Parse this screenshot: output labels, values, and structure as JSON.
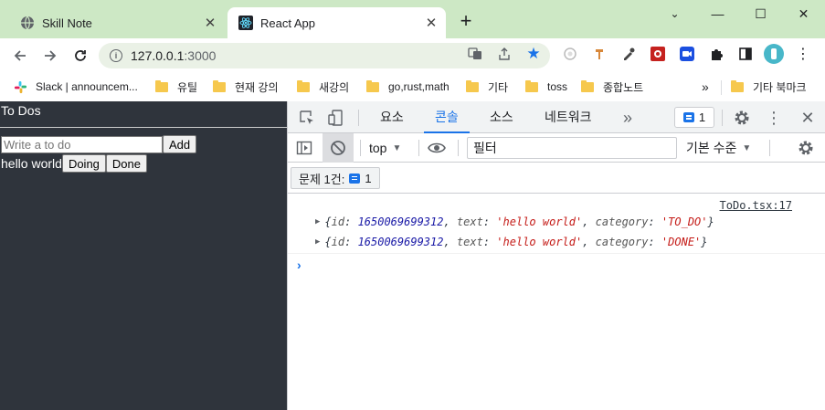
{
  "browser": {
    "tabs": [
      {
        "title": "Skill Note",
        "active": false,
        "icon": "globe-icon"
      },
      {
        "title": "React App",
        "active": true,
        "icon": "react-icon"
      }
    ],
    "url_host": "127.0.0.1",
    "url_port": ":3000",
    "bookmarks": [
      {
        "label": "Slack | announcem...",
        "icon": "slack-icon"
      },
      {
        "label": "유틸",
        "icon": "folder-icon"
      },
      {
        "label": "현재 강의",
        "icon": "folder-icon"
      },
      {
        "label": "새강의",
        "icon": "folder-icon"
      },
      {
        "label": "go,rust,math",
        "icon": "folder-icon"
      },
      {
        "label": "기타",
        "icon": "folder-icon"
      },
      {
        "label": "toss",
        "icon": "folder-icon"
      },
      {
        "label": "종합노트",
        "icon": "folder-icon"
      },
      {
        "label": "»",
        "icon": "more-bookmarks-icon"
      },
      {
        "label": "기타 북마크",
        "icon": "folder-icon"
      }
    ]
  },
  "app": {
    "title": "To Dos",
    "input_placeholder": "Write a to do",
    "add_label": "Add",
    "todos": [
      {
        "text": "hello world",
        "buttons": [
          "Doing",
          "Done"
        ]
      }
    ]
  },
  "devtools": {
    "tabs": [
      "요소",
      "콘솔",
      "소스",
      "네트워크"
    ],
    "active_tab": "콘솔",
    "issue_count": "1",
    "context": "top",
    "filter_placeholder": "필터",
    "level": "기본 수준",
    "issues_label": "문제 1건:",
    "issues_count": "1",
    "source_link": "ToDo.tsx:17",
    "logs": [
      {
        "id": "1650069699312",
        "text": "'hello world'",
        "category": "'TO_DO'"
      },
      {
        "id": "1650069699312",
        "text": "'hello world'",
        "category": "'DONE'"
      }
    ]
  },
  "colors": {
    "tabstrip": "#cde8c5",
    "page_bg": "#2f343c",
    "accent": "#1a73e8"
  }
}
